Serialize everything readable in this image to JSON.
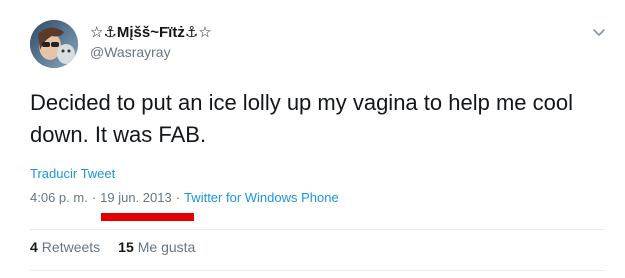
{
  "author": {
    "display_name": "☆⚓Mįšš~Fïtż⚓☆",
    "handle": "@Wasrayray"
  },
  "tweet": {
    "text": "Decided to put an ice lolly up my vagina to help me cool down. It was FAB.",
    "translate_label": "Traducir Tweet",
    "time": "4:06 p. m.",
    "separator": "·",
    "date": "19 jun. 2013",
    "source": "Twitter for Windows Phone"
  },
  "stats": {
    "retweets_count": "4",
    "retweets_label": "Retweets",
    "likes_count": "15",
    "likes_label": "Me gusta"
  },
  "colors": {
    "link": "#1b95e0",
    "highlight": "#e50000",
    "muted": "#657786"
  },
  "icons": {
    "menu": "chevron-down-icon"
  }
}
